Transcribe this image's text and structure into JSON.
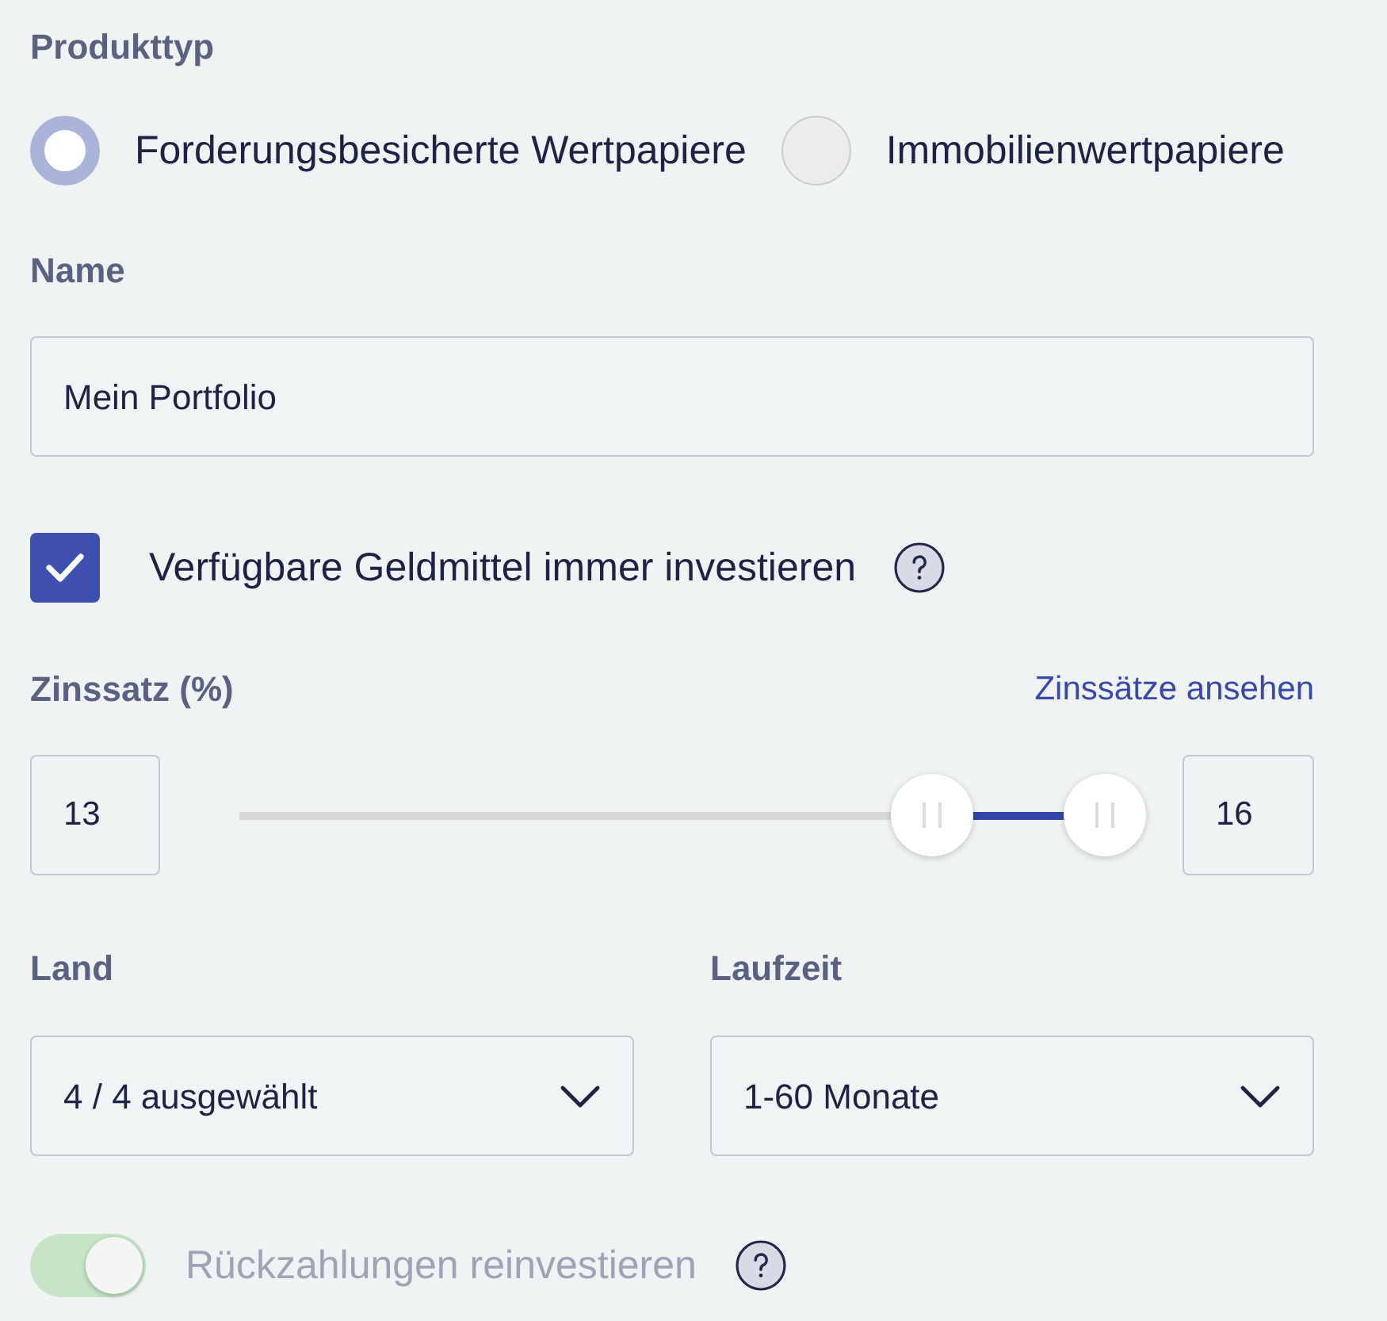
{
  "product_type": {
    "label": "Produkttyp",
    "options": [
      {
        "label": "Forderungsbesicherte Wertpapiere",
        "selected": true
      },
      {
        "label": "Immobilienwertpapiere",
        "selected": false
      }
    ]
  },
  "name": {
    "label": "Name",
    "value": "Mein Portfolio"
  },
  "auto_invest": {
    "label": "Verfügbare Geldmittel immer investieren",
    "checked": true
  },
  "interest_rate": {
    "label": "Zinssatz (%)",
    "link": "Zinssätze ansehen",
    "min_value": "13",
    "max_value": "16",
    "thumbs": [
      {
        "level": 0.8
      },
      {
        "level": 1
      }
    ]
  },
  "filters": [
    {
      "label": "Land",
      "value": "4 / 4 ausgewählt"
    },
    {
      "label": "Laufzeit",
      "value": "1-60 Monate"
    }
  ],
  "reinvest": {
    "label": "Rückzahlungen reinvestieren",
    "on": true,
    "disabled": true
  }
}
